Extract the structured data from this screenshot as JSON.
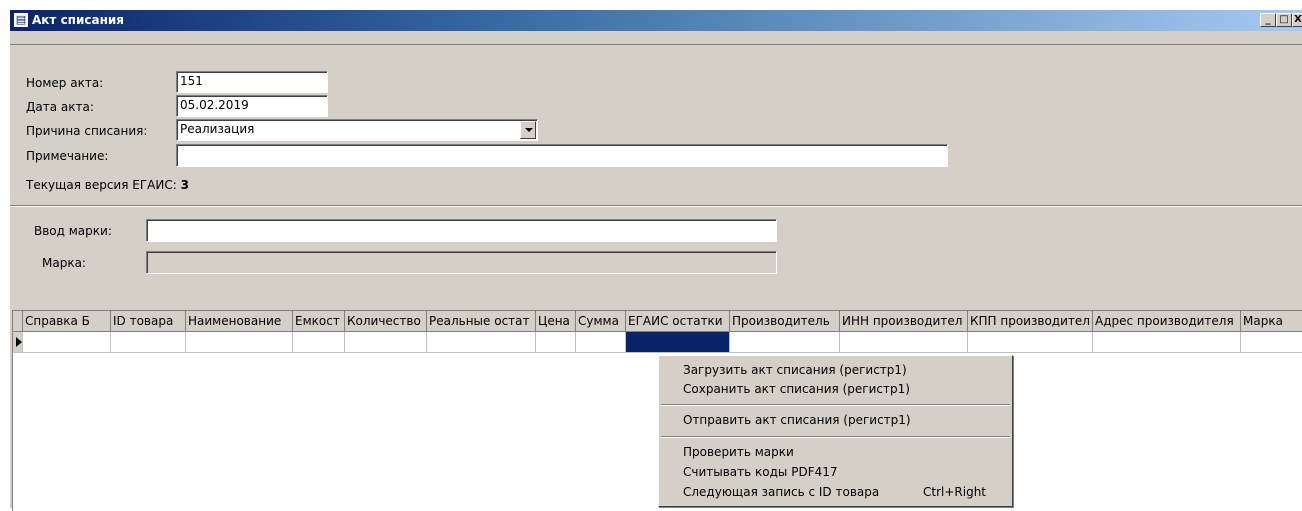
{
  "window": {
    "title": "Акт списания",
    "icon": "document-icon",
    "controls": {
      "minimize": "_",
      "maximize": "□",
      "close": "X"
    }
  },
  "form": {
    "act_number_label": "Номер акта:",
    "act_number_value": "151",
    "act_date_label": "Дата акта:",
    "act_date_value": "05.02.2019",
    "reason_label": "Причина списания:",
    "reason_value": "Реализация",
    "note_label": "Примечание:",
    "note_value": "",
    "egais_version_label": "Текущая версия ЕГАИС:",
    "egais_version_value": "3"
  },
  "mark": {
    "input_label": "Ввод марки:",
    "input_value": "",
    "mark_label": "Марка:",
    "mark_value": ""
  },
  "grid": {
    "columns": [
      "Справка Б",
      "ID товара",
      "Наименование",
      "Емкост",
      "Количество",
      "Реальные остат",
      "Цена",
      "Сумма",
      "ЕГАИС остатки",
      "Производитель",
      "ИНН производител",
      "КПП производител",
      "Адрес производителя",
      "Марка"
    ],
    "rows": [
      [
        "",
        "",
        "",
        "",
        "",
        "",
        "",
        "",
        "",
        "",
        "",
        "",
        "",
        ""
      ]
    ]
  },
  "context_menu": {
    "items": [
      {
        "label": "Загрузить акт списания (регистр1)",
        "shortcut": ""
      },
      {
        "label": "Сохранить акт списания (регистр1)",
        "shortcut": ""
      },
      {
        "label": "Отправить акт списания (регистр1)",
        "shortcut": ""
      },
      {
        "label": "Проверить марки",
        "shortcut": ""
      },
      {
        "label": "Считывать коды PDF417",
        "shortcut": ""
      },
      {
        "label": "Следующая запись с  ID товара",
        "shortcut": "Ctrl+Right"
      }
    ]
  }
}
